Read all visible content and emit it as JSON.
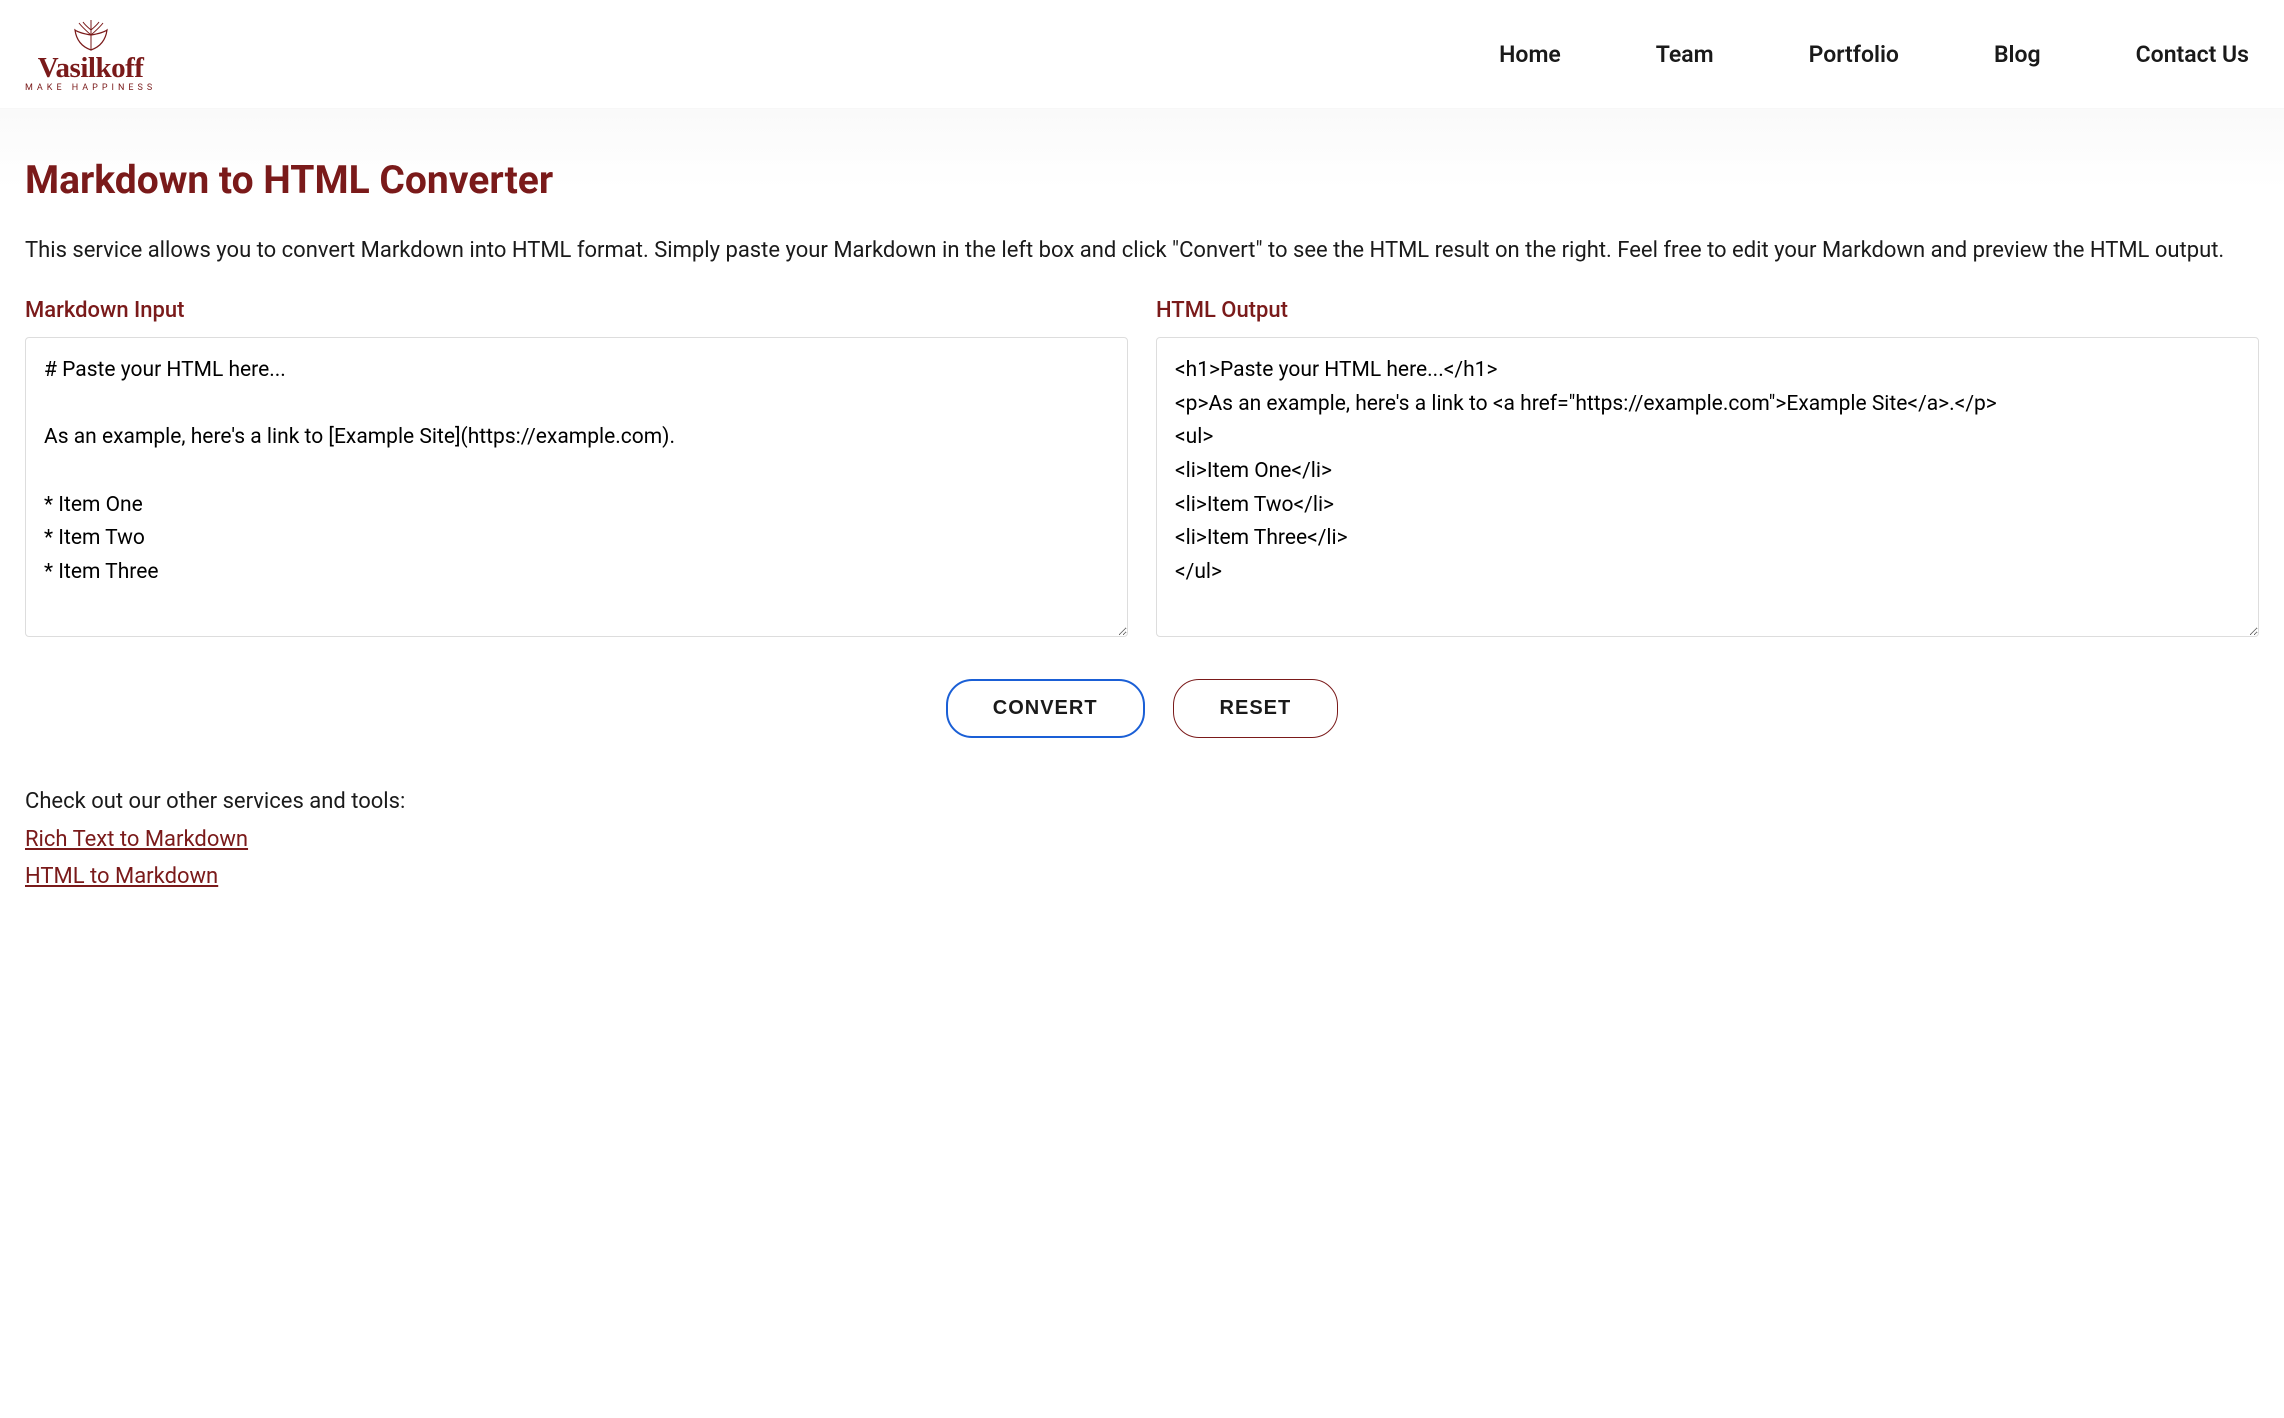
{
  "brand": {
    "name": "Vasilkoff",
    "tagline": "MAKE HAPPINESS"
  },
  "nav": {
    "home": "Home",
    "team": "Team",
    "portfolio": "Portfolio",
    "blog": "Blog",
    "contact": "Contact Us"
  },
  "page": {
    "title": "Markdown to HTML Converter",
    "description": "This service allows you to convert Markdown into HTML format. Simply paste your Markdown in the left box and click \"Convert\" to see the HTML result on the right. Feel free to edit your Markdown and preview the HTML output."
  },
  "converter": {
    "input_label": "Markdown Input",
    "output_label": "HTML Output",
    "input_value": "# Paste your HTML here...\n\nAs an example, here's a link to [Example Site](https://example.com).\n\n* Item One\n* Item Two\n* Item Three",
    "output_value": "<h1>Paste your HTML here...</h1>\n<p>As an example, here's a link to <a href=\"https://example.com\">Example Site</a>.</p>\n<ul>\n<li>Item One</li>\n<li>Item Two</li>\n<li>Item Three</li>\n</ul>"
  },
  "buttons": {
    "convert": "CONVERT",
    "reset": "RESET"
  },
  "footer": {
    "intro": "Check out our other services and tools:",
    "link1": "Rich Text to Markdown",
    "link2": "HTML to Markdown"
  },
  "colors": {
    "brand": "#7a1a1a",
    "accent": "#1a5fd6"
  }
}
